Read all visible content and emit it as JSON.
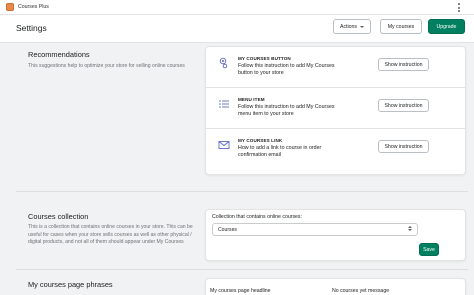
{
  "app": {
    "name": "Courses Plus"
  },
  "header": {
    "title": "Settings",
    "actions_label": "Actions",
    "my_courses_label": "My courses",
    "upgrade_label": "Upgrade"
  },
  "recommendations": {
    "title": "Recommendations",
    "description": "This suggestions help to optimize your store for selling online courses",
    "items": [
      {
        "icon": "link-gear-icon",
        "label": "MY COURSES BUTTON",
        "text": "Follow this instruction to add My Courses button to your store",
        "button": "Show instruction"
      },
      {
        "icon": "list-icon",
        "label": "MENU ITEM",
        "text": "Follow this instruction to add My Courses menu item to your store",
        "button": "Show instruction"
      },
      {
        "icon": "mail-icon",
        "label": "MY COURSES LINK",
        "text": "How to add a link to course in order confirmation email",
        "button": "Show instruction"
      }
    ]
  },
  "collection": {
    "title": "Courses collection",
    "description": "This is a collection that contains online courses in your store. This can be useful for cases when your store sells courses as well as other physical / digital products, and not all of them should appear under My Courses",
    "field_label": "Collection that contains online courses:",
    "selected": "Courses",
    "save_label": "Save"
  },
  "phrases": {
    "title": "My courses page phrases",
    "col1_label": "My courses page headline",
    "col2_label": "No courses yet message"
  },
  "colors": {
    "primary": "#008060",
    "background": "#f1f2f3",
    "card": "#ffffff"
  }
}
